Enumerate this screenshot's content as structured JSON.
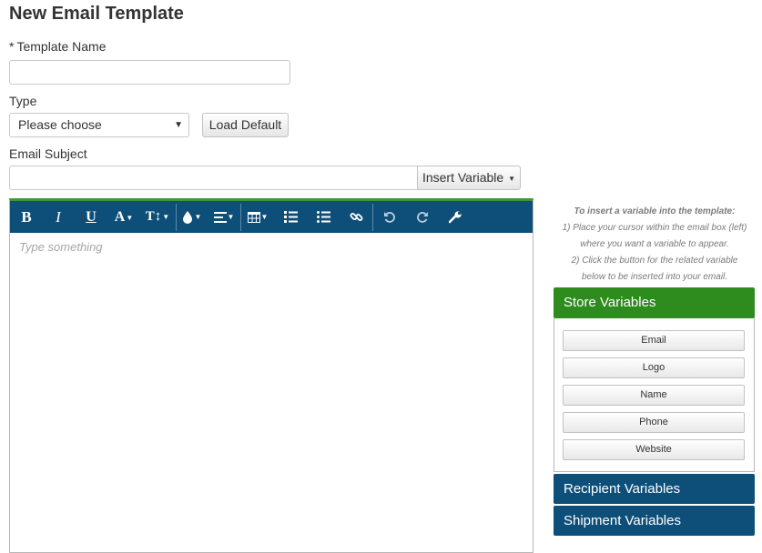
{
  "page": {
    "title": "New Email Template"
  },
  "form": {
    "template_name_required_mark": "*",
    "template_name_label": "Template Name",
    "template_name_value": "",
    "type_label": "Type",
    "type_selected": "Please choose",
    "load_default_label": "Load Default",
    "email_subject_label": "Email Subject",
    "email_subject_value": "",
    "insert_variable_label": "Insert Variable"
  },
  "editor": {
    "placeholder": "Type something",
    "toolbar": {
      "colors": {
        "background": "#0e4f79",
        "top_border": "#3b9a37"
      },
      "buttons": [
        "bold-icon",
        "italic-icon",
        "underline-icon",
        "font-family-icon",
        "font-size-icon",
        "color-icon",
        "align-icon",
        "table-icon",
        "ordered-list-icon",
        "unordered-list-icon",
        "link-icon",
        "undo-icon",
        "redo-icon",
        "wrench-icon"
      ]
    }
  },
  "hint": {
    "heading": "To insert a variable into the template:",
    "line1": "1) Place your cursor within the email box (left)",
    "line2": "where you want a variable to appear.",
    "line3": "2) Click the button for the related variable",
    "line4": "below to be inserted into your email."
  },
  "variables": {
    "store": {
      "title": "Store Variables",
      "color": "#2e8b1d",
      "items": [
        "Email",
        "Logo",
        "Name",
        "Phone",
        "Website"
      ]
    },
    "recipient": {
      "title": "Recipient Variables",
      "color": "#0e4f79"
    },
    "shipment": {
      "title": "Shipment Variables",
      "color": "#0e4f79"
    }
  }
}
